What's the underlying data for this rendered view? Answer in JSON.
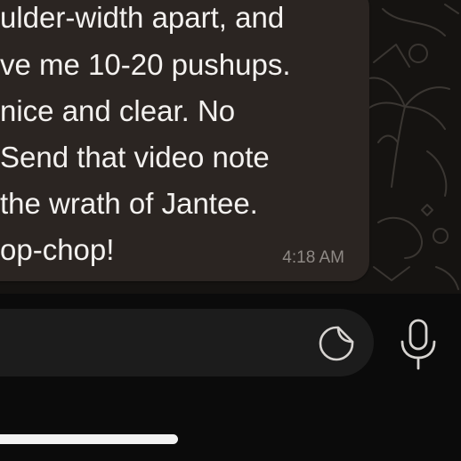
{
  "message": {
    "lines": [
      "ulder-width apart, and",
      "ve me 10-20 pushups.",
      "nice and clear. No",
      " Send that video note",
      " the wrath of Jantee.",
      "op-chop!"
    ],
    "time": "4:18 AM"
  },
  "composer": {
    "sticker_icon": "sticker-icon",
    "mic_icon": "microphone-icon"
  },
  "colors": {
    "bubble": "#2b2522",
    "chat_background": "#151311",
    "input_background": "#1c1c1c",
    "text": "#f3f1ef",
    "timestamp": "#8e8985"
  }
}
